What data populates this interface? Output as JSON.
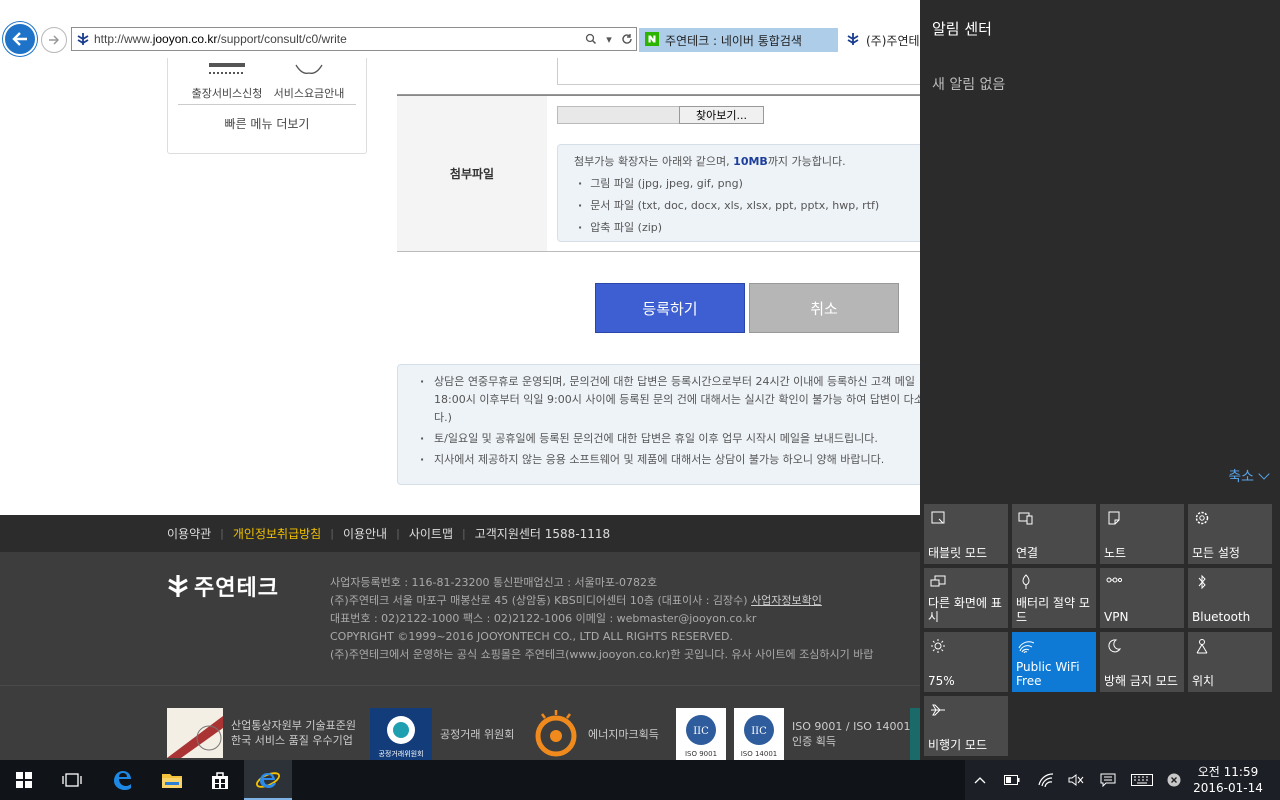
{
  "browser": {
    "url_prefix": "http://www.",
    "url_domain": "jooyon.co.kr",
    "url_path": "/support/consult/c0/write",
    "tabs": [
      {
        "label": "주연테크 : 네이버 통합검색"
      },
      {
        "label": "(주)주연테"
      }
    ]
  },
  "quick_menu": {
    "items": [
      {
        "label": "출장서비스신청",
        "icon": "dotted-line-icon"
      },
      {
        "label": "서비스요금안내",
        "icon": "badge-icon"
      }
    ],
    "more_label": "빠른 메뉴 더보기"
  },
  "attachment": {
    "header": "첨부파일",
    "browse_label": "찾아보기...",
    "file_value": "",
    "intro_prefix": "첨부가능 확장자는 아래와 같으며, ",
    "intro_size": "10MB",
    "intro_suffix": "까지 가능합니다.",
    "types": [
      "그림 파일 (jpg, jpeg, gif, png)",
      "문서 파일 (txt, doc, docx, xls, xlsx, ppt, pptx, hwp, rtf)",
      "압축 파일 (zip)"
    ]
  },
  "buttons": {
    "submit": "등록하기",
    "cancel": "취소"
  },
  "notices": [
    "상담은 연중무휴로 운영되며, 문의건에 대한 답변은 등록시간으로부터 24시간 이내에 등록하신 고객 메일",
    "18:00시 이후부터 익일 9:00시 사이에 등록된 문의 건에 대해서는 실시간 확인이 불가능 하여 답변이 다소",
    "다.)",
    "토/일요일 및 공휴일에 등록된 문의건에 대한 답변은 휴일 이후 업무 시작시 메일을 보내드립니다.",
    "지사에서 제공하지 않는 응용 소프트웨어 및 제품에 대해서는 상담이 불가능 하오니 양해 바랍니다."
  ],
  "footer": {
    "links": [
      "이용약관",
      "개인정보취급방침",
      "이용안내",
      "사이트맵",
      "고객지원센터 1588-1118"
    ],
    "logo_text": "주연테크",
    "info": [
      "사업자등록번호 : 116-81-23200    통신판매업신고 : 서울마포-0782호",
      "(주)주연테크 서울 마포구 매봉산로 45 (상암동) KBS미디어센터 10층 (대표이사 : 김장수)",
      "대표번호 : 02)2122-1000    팩스 : 02)2122-1006       이메일 : webmaster@jooyon.co.kr",
      "COPYRIGHT ©1999~2016 JOOYONTECH CO., LTD ALL RIGHTS RESERVED.",
      "(주)주연테크에서 운영하는 공식 쇼핑몰은 주연테크(www.jooyon.co.kr)한 곳입니다. 유사 사이트에 조심하시기 바랍"
    ],
    "info_link": "사업자정보확인",
    "certs": [
      {
        "line1": "산업통상자원부 기술표준원",
        "line2": "한국 서비스 품질 우수기업"
      },
      {
        "line1": "공정거래 위원회",
        "line2": ""
      },
      {
        "line1": "에너지마크획득",
        "line2": ""
      },
      {
        "line1": "ISO 9001 / ISO 14001",
        "line2": "인증 획득"
      }
    ],
    "cert_badges": [
      "ISO 9001",
      "ISO 14001"
    ],
    "cert_badge_text": "IIC",
    "ftc_badge_text": "공정거래위원회"
  },
  "action_center": {
    "title": "알림 센터",
    "empty": "새 알림 없음",
    "collapse": "축소",
    "tiles": [
      {
        "label": "태블릿 모드",
        "icon": "tablet-mode-icon",
        "on": false
      },
      {
        "label": "연결",
        "icon": "connect-icon",
        "on": false
      },
      {
        "label": "노트",
        "icon": "note-icon",
        "on": false
      },
      {
        "label": "모든 설정",
        "icon": "settings-icon",
        "on": false
      },
      {
        "label": "다른 화면에 표시",
        "icon": "project-icon",
        "on": false
      },
      {
        "label": "배터리 절약 모드",
        "icon": "battery-saver-icon",
        "on": false
      },
      {
        "label": "VPN",
        "icon": "vpn-icon",
        "on": false
      },
      {
        "label": "Bluetooth",
        "icon": "bluetooth-icon",
        "on": false
      },
      {
        "label": "75%",
        "icon": "brightness-icon",
        "on": false
      },
      {
        "label": "Public WiFi Free",
        "icon": "wifi-icon",
        "on": true
      },
      {
        "label": "방해 금지 모드",
        "icon": "quiet-hours-icon",
        "on": false
      },
      {
        "label": "위치",
        "icon": "location-icon",
        "on": false
      },
      {
        "label": "비행기 모드",
        "icon": "airplane-icon",
        "on": false
      }
    ]
  },
  "taskbar": {
    "time": "오전 11:59",
    "date": "2016-01-14"
  },
  "colors": {
    "accent": "#0f7ad6",
    "submit": "#3d5fd1",
    "footer_highlight": "#f2c200"
  }
}
